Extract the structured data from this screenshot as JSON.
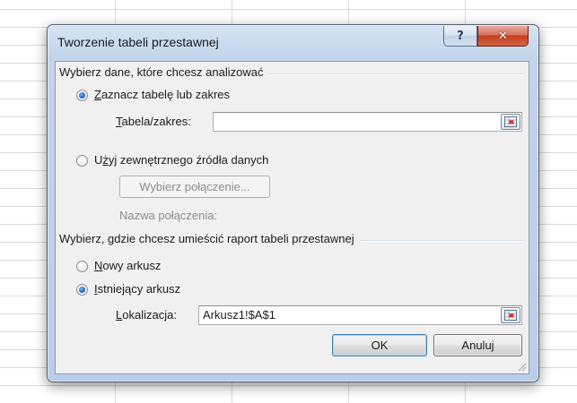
{
  "dialog": {
    "title": "Tworzenie tabeli przestawnej",
    "help_glyph": "?",
    "close_glyph": "✕"
  },
  "source_section": {
    "label": "Wybierz dane, które chcesz analizować",
    "option_table": {
      "accel": "Z",
      "rest": "aznacz tabelę lub zakres",
      "checked": true
    },
    "table_range": {
      "accel": "T",
      "rest": "abela/zakres:",
      "value": ""
    },
    "option_external": {
      "accel": "ż",
      "pre": "U",
      "rest": "yj zewnętrznego źródła danych",
      "checked": false
    },
    "choose_connection_label": "Wybierz połączenie...",
    "connection_name_label": "Nazwa połączenia:"
  },
  "destination_section": {
    "label": "Wybierz, gdzie chcesz umieścić raport tabeli przestawnej",
    "option_new": {
      "accel": "N",
      "rest": "owy arkusz",
      "checked": false
    },
    "option_existing": {
      "accel": "I",
      "rest": "stniejący arkusz",
      "checked": true
    },
    "location": {
      "accel": "L",
      "rest": "okalizacja:",
      "value": "Arkusz1!$A$1"
    }
  },
  "buttons": {
    "ok": "OK",
    "cancel": "Anuluj"
  },
  "colors": {
    "radio_accent": "#2a6ad1",
    "close_button": "#c4401f",
    "default_button_border": "#3c7fb1"
  }
}
